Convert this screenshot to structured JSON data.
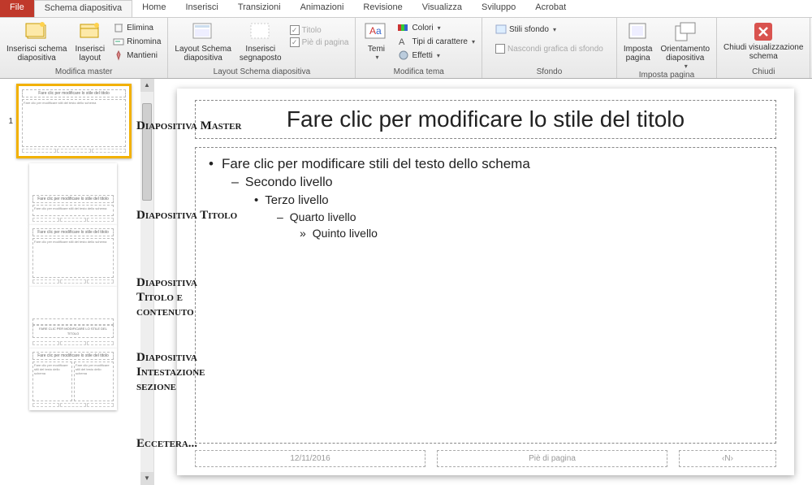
{
  "tabs": {
    "file": "File",
    "active": "Schema diapositiva",
    "items": [
      "Home",
      "Inserisci",
      "Transizioni",
      "Animazioni",
      "Revisione",
      "Visualizza",
      "Sviluppo",
      "Acrobat"
    ]
  },
  "ribbon": {
    "g1": {
      "label": "Modifica master",
      "insert_schema": "Inserisci schema\ndiapositiva",
      "insert_layout": "Inserisci\nlayout",
      "delete": "Elimina",
      "rename": "Rinomina",
      "keep": "Mantieni"
    },
    "g2": {
      "label": "Layout Schema diapositiva",
      "layout": "Layout Schema\ndiapositiva",
      "placeholder": "Inserisci\nsegnaposto",
      "title": "Titolo",
      "footer": "Piè di pagina"
    },
    "g3": {
      "label": "Modifica tema",
      "themes": "Temi",
      "colors": "Colori",
      "fonts": "Tipi di carattere",
      "effects": "Effetti"
    },
    "g4": {
      "label": "Sfondo",
      "styles": "Stili sfondo",
      "hide": "Nascondi grafica di sfondo"
    },
    "g5": {
      "label": "Imposta pagina",
      "setup": "Imposta\npagina",
      "orient": "Orientamento\ndiapositiva"
    },
    "g6": {
      "label": "Chiudi",
      "close": "Chiudi visualizzazione\nschema"
    }
  },
  "labels": {
    "master": "Diapositiva Master",
    "title": "Diapositiva Titolo",
    "content": "Diapositiva\nTitolo e contenuto",
    "section": "Diapositiva\nIntestazione sezione",
    "etc": "Eccetera..."
  },
  "thumb_text": {
    "title": "Fare clic per modificare lo stile del titolo",
    "body": "Fare clic per modificare stili del testo dello schema",
    "section": "FARE CLIC PER MODIFICARE LO STILE DEL TITOLO"
  },
  "slide": {
    "title": "Fare clic per modificare lo stile del titolo",
    "lv1": "Fare clic per modificare stili del testo dello schema",
    "lv2": "Secondo livello",
    "lv3": "Terzo livello",
    "lv4": "Quarto livello",
    "lv5": "Quinto livello",
    "date": "12/11/2016",
    "footer": "Piè di pagina",
    "num": "‹N›"
  },
  "master_num": "1"
}
